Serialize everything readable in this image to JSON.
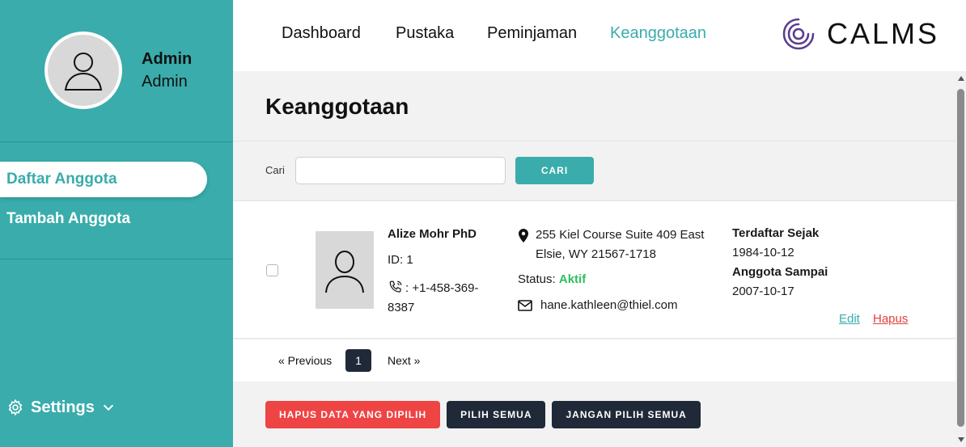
{
  "sidebar": {
    "user_name": "Admin",
    "user_role": "Admin",
    "menu": [
      {
        "label": "Daftar Anggota",
        "active": true
      },
      {
        "label": "Tambah Anggota",
        "active": false
      }
    ],
    "settings_label": "Settings"
  },
  "nav": {
    "links": [
      "Dashboard",
      "Pustaka",
      "Peminjaman",
      "Keanggotaan"
    ],
    "active": "Keanggotaan",
    "logo_text": "CALMS"
  },
  "page": {
    "title": "Keanggotaan"
  },
  "search": {
    "label": "Cari",
    "value": "",
    "placeholder": "",
    "button": "CARI"
  },
  "members": [
    {
      "name": "Alize Mohr PhD",
      "id_text": "ID: 1",
      "phone": ": +1-458-369-8387",
      "address": "255 Kiel Course Suite 409 East Elsie, WY 21567-1718",
      "status_label": "Status:",
      "status_value": "Aktif",
      "email": "hane.kathleen@thiel.com",
      "registered_label": "Terdaftar Sejak",
      "registered_date": "1984-10-12",
      "member_until_label": "Anggota Sampai",
      "member_until_date": "2007-10-17",
      "edit_label": "Edit",
      "delete_label": "Hapus",
      "checked": false
    }
  ],
  "pagination": {
    "previous": "« Previous",
    "current": "1",
    "next": "Next »"
  },
  "actions": {
    "delete_selected": "HAPUS DATA YANG DIPILIH",
    "select_all": "PILIH SEMUA",
    "deselect_all": "JANGAN PILIH SEMUA"
  },
  "colors": {
    "accent": "#3aacac",
    "danger": "#ef4444",
    "dark": "#1f2937",
    "status_active": "#2fbf5e"
  }
}
